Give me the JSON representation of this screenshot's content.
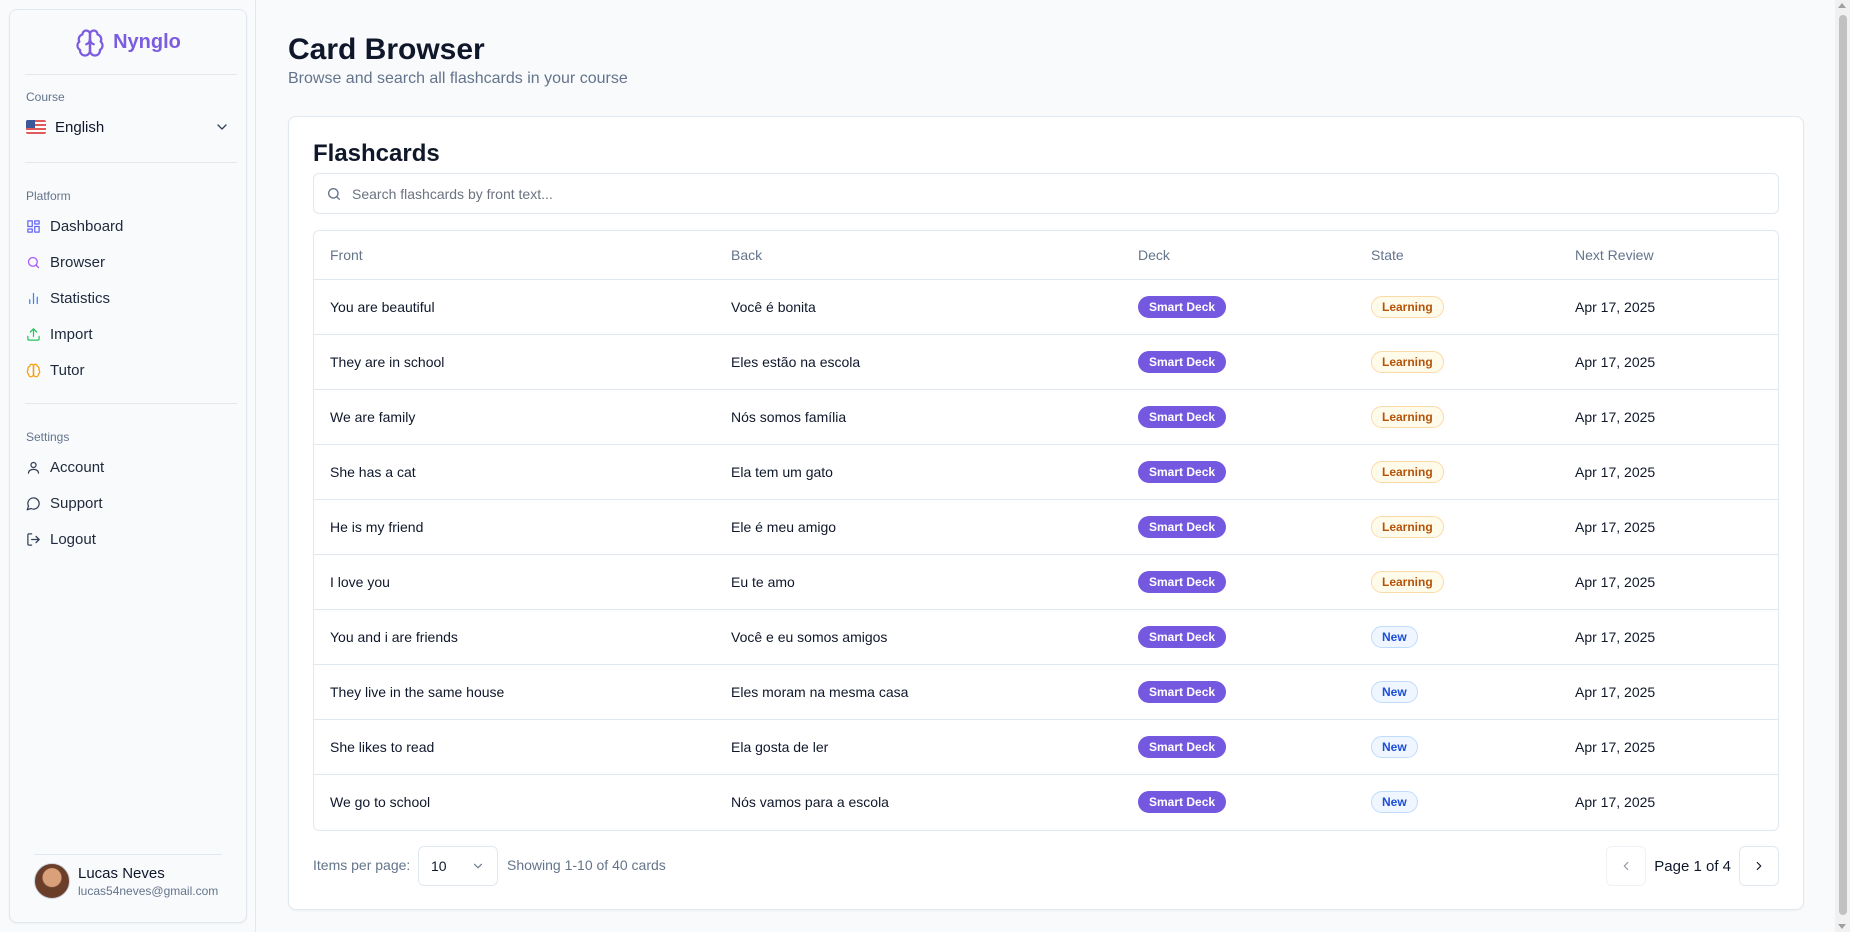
{
  "app": {
    "name": "Nynglo"
  },
  "sidebar": {
    "course_label": "Course",
    "course": {
      "value": "English",
      "flag_icon": "us-flag-icon"
    },
    "platform_label": "Platform",
    "platform_items": [
      {
        "label": "Dashboard",
        "icon": "dashboard-icon",
        "color": "#6366f1"
      },
      {
        "label": "Browser",
        "icon": "search-icon",
        "color": "#a855f7"
      },
      {
        "label": "Statistics",
        "icon": "bar-chart-icon",
        "color": "#3b82f6"
      },
      {
        "label": "Import",
        "icon": "upload-icon",
        "color": "#22c55e"
      },
      {
        "label": "Tutor",
        "icon": "brain-icon",
        "color": "#f59e0b"
      }
    ],
    "settings_label": "Settings",
    "settings_items": [
      {
        "label": "Account",
        "icon": "user-icon"
      },
      {
        "label": "Support",
        "icon": "message-circle-icon"
      },
      {
        "label": "Logout",
        "icon": "logout-icon"
      }
    ],
    "user": {
      "name": "Lucas Neves",
      "email": "lucas54neves@gmail.com"
    }
  },
  "header": {
    "title": "Card Browser",
    "subtitle": "Browse and search all flashcards in your course"
  },
  "flashcards": {
    "title": "Flashcards",
    "search_placeholder": "Search flashcards by front text...",
    "search_value": "",
    "columns": [
      "Front",
      "Back",
      "Deck",
      "State",
      "Next Review"
    ],
    "rows": [
      {
        "front": "You are beautiful",
        "back": "Você é bonita",
        "deck": "Smart Deck",
        "state": "Learning",
        "next_review": "Apr 17, 2025"
      },
      {
        "front": "They are in school",
        "back": "Eles estão na escola",
        "deck": "Smart Deck",
        "state": "Learning",
        "next_review": "Apr 17, 2025"
      },
      {
        "front": "We are family",
        "back": "Nós somos família",
        "deck": "Smart Deck",
        "state": "Learning",
        "next_review": "Apr 17, 2025"
      },
      {
        "front": "She has a cat",
        "back": "Ela tem um gato",
        "deck": "Smart Deck",
        "state": "Learning",
        "next_review": "Apr 17, 2025"
      },
      {
        "front": "He is my friend",
        "back": "Ele é meu amigo",
        "deck": "Smart Deck",
        "state": "Learning",
        "next_review": "Apr 17, 2025"
      },
      {
        "front": "I love you",
        "back": "Eu te amo",
        "deck": "Smart Deck",
        "state": "Learning",
        "next_review": "Apr 17, 2025"
      },
      {
        "front": "You and i are friends",
        "back": "Você e eu somos amigos",
        "deck": "Smart Deck",
        "state": "New",
        "next_review": "Apr 17, 2025"
      },
      {
        "front": "They live in the same house",
        "back": "Eles moram na mesma casa",
        "deck": "Smart Deck",
        "state": "New",
        "next_review": "Apr 17, 2025"
      },
      {
        "front": "She likes to read",
        "back": "Ela gosta de ler",
        "deck": "Smart Deck",
        "state": "New",
        "next_review": "Apr 17, 2025"
      },
      {
        "front": "We go to school",
        "back": "Nós vamos para a escola",
        "deck": "Smart Deck",
        "state": "New",
        "next_review": "Apr 17, 2025"
      }
    ],
    "pagination": {
      "items_per_page_label": "Items per page:",
      "items_per_page": "10",
      "showing": "Showing 1-10 of 40 cards",
      "page_text": "Page 1 of 4"
    }
  },
  "colors": {
    "brand": "#7c5cdf",
    "deck_badge": "#7458e0",
    "learning": "#b45309",
    "new": "#1d4ed8"
  }
}
